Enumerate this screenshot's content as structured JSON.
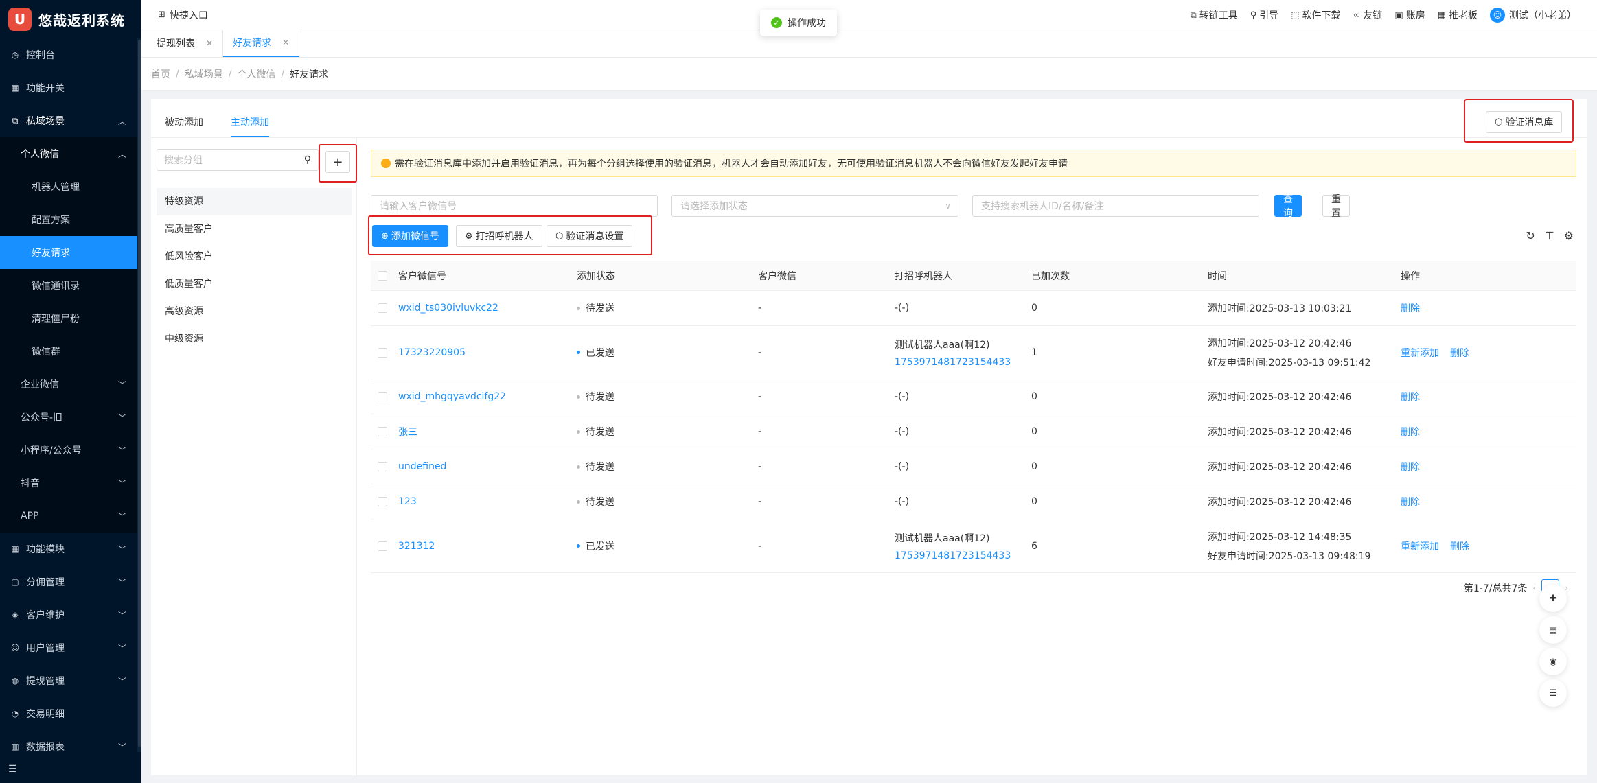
{
  "app": {
    "logo_char": "U",
    "title": "悠哉返利系统"
  },
  "sidebar": {
    "items": [
      {
        "label": "控制台",
        "icon": "dashboard-icon",
        "level": 0
      },
      {
        "label": "功能开关",
        "icon": "switch-icon",
        "level": 0
      },
      {
        "label": "私域场景",
        "icon": "scene-icon",
        "level": 0,
        "expanded": true
      },
      {
        "label": "个人微信",
        "level": 1,
        "expanded": true
      },
      {
        "label": "机器人管理",
        "level": 2
      },
      {
        "label": "配置方案",
        "level": 2
      },
      {
        "label": "好友请求",
        "level": 2,
        "active": true
      },
      {
        "label": "微信通讯录",
        "level": 2
      },
      {
        "label": "清理僵尸粉",
        "level": 2
      },
      {
        "label": "微信群",
        "level": 2
      },
      {
        "label": "企业微信",
        "level": 1
      },
      {
        "label": "公众号-旧",
        "level": 1
      },
      {
        "label": "小程序/公众号",
        "level": 1
      },
      {
        "label": "抖音",
        "level": 1
      },
      {
        "label": "APP",
        "level": 1
      },
      {
        "label": "功能模块",
        "icon": "module-icon",
        "level": 0
      },
      {
        "label": "分佣管理",
        "icon": "commission-icon",
        "level": 0
      },
      {
        "label": "客户维护",
        "icon": "customer-icon",
        "level": 0
      },
      {
        "label": "用户管理",
        "icon": "user-icon",
        "level": 0
      },
      {
        "label": "提现管理",
        "icon": "withdraw-icon",
        "level": 0
      },
      {
        "label": "交易明细",
        "icon": "trade-icon",
        "level": 0
      },
      {
        "label": "数据报表",
        "icon": "report-icon",
        "level": 0
      }
    ]
  },
  "header": {
    "quick": "快捷入口",
    "links": [
      "转链工具",
      "引导",
      "软件下载",
      "友链",
      "账房",
      "推老板"
    ],
    "user": "测试（小老弟）"
  },
  "toast": "操作成功",
  "page_tabs": [
    "提现列表",
    "好友请求"
  ],
  "breadcrumb": [
    "首页",
    "私域场景",
    "个人微信",
    "好友请求"
  ],
  "subtabs": [
    "被动添加",
    "主动添加"
  ],
  "verify_lib_btn": "验证消息库",
  "group": {
    "search_placeholder": "搜索分组",
    "add_symbol": "+",
    "items": [
      "特级资源",
      "高质量客户",
      "低风险客户",
      "低质量客户",
      "高级资源",
      "中级资源"
    ]
  },
  "notice": "需在验证消息库中添加并启用验证消息，再为每个分组选择使用的验证消息，机器人才会自动添加好友，无可使用验证消息机器人不会向微信好友发起好友申请",
  "filters": {
    "wxid_placeholder": "请输入客户微信号",
    "status_placeholder": "请选择添加状态",
    "robot_placeholder": "支持搜索机器人ID/名称/备注",
    "search_btn": "查 询",
    "reset_btn": "重 置"
  },
  "actions": {
    "add": "添加微信号",
    "greet_robot": "打招呼机器人",
    "verify_setting": "验证消息设置"
  },
  "table": {
    "headers": [
      "客户微信号",
      "添加状态",
      "客户微信",
      "打招呼机器人",
      "已加次数",
      "时间",
      "操作"
    ],
    "rows": [
      {
        "wxid": "wxid_ts030ivluvkc22",
        "status": "待发送",
        "sent": false,
        "customer": "-",
        "robot": "-(-)",
        "robot_id": "",
        "count": "0",
        "time1": "添加时间:2025-03-13 10:03:21",
        "time2": "",
        "ops": [
          "删除"
        ]
      },
      {
        "wxid": "17323220905",
        "status": "已发送",
        "sent": true,
        "customer": "-",
        "robot": "测试机器人aaa(啊12)",
        "robot_id": "1753971481723154433",
        "count": "1",
        "time1": "添加时间:2025-03-12 20:42:46",
        "time2": "好友申请时间:2025-03-13 09:51:42",
        "ops": [
          "重新添加",
          "删除"
        ]
      },
      {
        "wxid": "wxid_mhgqyavdcifg22",
        "status": "待发送",
        "sent": false,
        "customer": "-",
        "robot": "-(-)",
        "robot_id": "",
        "count": "0",
        "time1": "添加时间:2025-03-12 20:42:46",
        "time2": "",
        "ops": [
          "删除"
        ]
      },
      {
        "wxid": "张三",
        "status": "待发送",
        "sent": false,
        "customer": "-",
        "robot": "-(-)",
        "robot_id": "",
        "count": "0",
        "time1": "添加时间:2025-03-12 20:42:46",
        "time2": "",
        "ops": [
          "删除"
        ]
      },
      {
        "wxid": "undefined",
        "status": "待发送",
        "sent": false,
        "customer": "-",
        "robot": "-(-)",
        "robot_id": "",
        "count": "0",
        "time1": "添加时间:2025-03-12 20:42:46",
        "time2": "",
        "ops": [
          "删除"
        ]
      },
      {
        "wxid": "123",
        "status": "待发送",
        "sent": false,
        "customer": "-",
        "robot": "-(-)",
        "robot_id": "",
        "count": "0",
        "time1": "添加时间:2025-03-12 20:42:46",
        "time2": "",
        "ops": [
          "删除"
        ]
      },
      {
        "wxid": "321312",
        "status": "已发送",
        "sent": true,
        "customer": "-",
        "robot": "测试机器人aaa(啊12)",
        "robot_id": "1753971481723154433",
        "count": "6",
        "time1": "添加时间:2025-03-12 14:48:35",
        "time2": "好友申请时间:2025-03-13 09:48:19",
        "ops": [
          "重新添加",
          "删除"
        ]
      }
    ]
  },
  "pagination": {
    "summary": "第1-7/总共7条"
  },
  "colors": {
    "primary": "#1890ff",
    "sidebar": "#001529",
    "highlight": "#e02020"
  }
}
